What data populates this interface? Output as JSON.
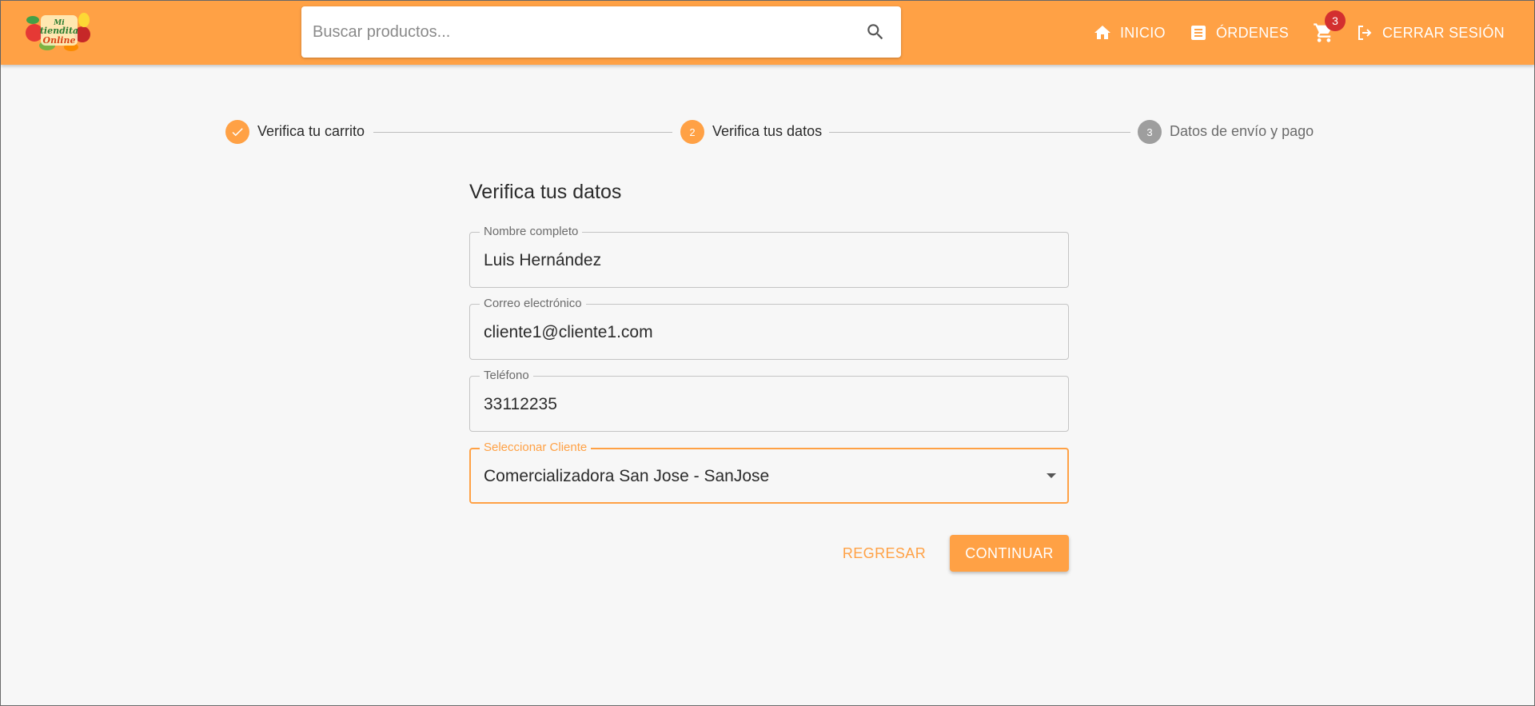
{
  "header": {
    "search_placeholder": "Buscar productos...",
    "nav": {
      "home": "INICIO",
      "orders": "ÓRDENES",
      "cart_count": "3",
      "logout": "CERRAR SESIÓN"
    },
    "logo_text": "Mi tiendita Online"
  },
  "stepper": {
    "steps": [
      {
        "label": "Verifica tu carrito",
        "state": "completed",
        "number": ""
      },
      {
        "label": "Verifica tus datos",
        "state": "active",
        "number": "2"
      },
      {
        "label": "Datos de envío y pago",
        "state": "pending",
        "number": "3"
      }
    ]
  },
  "form": {
    "title": "Verifica tus datos",
    "fields": [
      {
        "label": "Nombre completo",
        "value": "Luis Hernández"
      },
      {
        "label": "Correo electrónico",
        "value": "cliente1@cliente1.com"
      },
      {
        "label": "Teléfono",
        "value": "33112235"
      },
      {
        "label": "Seleccionar Cliente",
        "value": "Comercializadora San Jose - SanJose"
      }
    ],
    "back_label": "REGRESAR",
    "continue_label": "CONTINUAR"
  },
  "colors": {
    "accent": "#ffa145",
    "badge": "#d32f2f",
    "pending_step": "#9e9e9e"
  },
  "icons": [
    "home-icon",
    "orders-icon",
    "cart-icon",
    "logout-icon",
    "search-icon",
    "check-icon",
    "dropdown-caret-icon"
  ]
}
